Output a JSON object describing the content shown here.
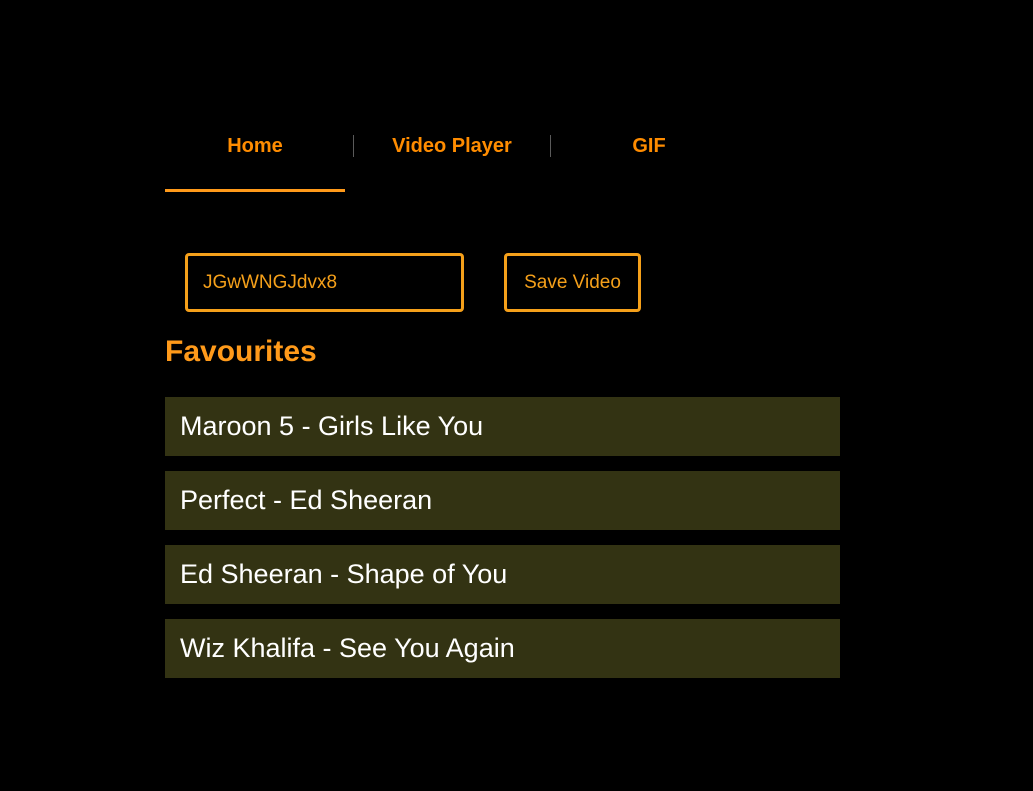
{
  "nav": {
    "tabs": [
      {
        "label": "Home",
        "active": true
      },
      {
        "label": "Video Player",
        "active": false
      },
      {
        "label": "GIF",
        "active": false
      }
    ]
  },
  "form": {
    "video_id_value": "JGwWNGJdvx8",
    "save_label": "Save Video"
  },
  "favourites": {
    "title": "Favourites",
    "items": [
      "Maroon 5 - Girls Like You",
      "Perfect - Ed Sheeran",
      "Ed Sheeran - Shape of You",
      "Wiz Khalifa - See You Again"
    ]
  },
  "colors": {
    "background": "#000000",
    "accent": "#ff9a1a",
    "list_item_background": "#333313",
    "list_item_text": "#ffffff"
  }
}
